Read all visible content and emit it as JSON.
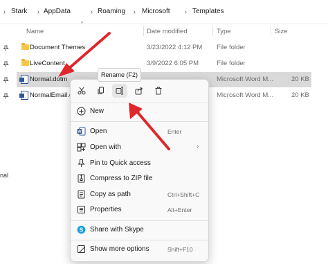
{
  "breadcrumb": {
    "items": [
      "Stark",
      "AppData",
      "Roaming",
      "Microsoft",
      "Templates"
    ],
    "separator_icon": "chevron-right-icon"
  },
  "columns": {
    "name": "Name",
    "date_modified": "Date modified",
    "type": "Type",
    "size": "Size"
  },
  "files": [
    {
      "name": "Document Themes",
      "date": "3/23/2022 4:12 PM",
      "type": "File folder",
      "size": "",
      "icon": "folder-icon"
    },
    {
      "name": "LiveContent",
      "date": "3/9/2022 6:05 PM",
      "type": "File folder",
      "size": "",
      "icon": "folder-icon"
    },
    {
      "name": "Normal.dotm",
      "date": "",
      "type": "Microsoft Word M...",
      "size": "20 KB",
      "icon": "word-doc-icon"
    },
    {
      "name": "NormalEmail.d",
      "date": "",
      "type": "Microsoft Word M...",
      "size": "20 KB",
      "icon": "word-doc-icon"
    }
  ],
  "left_strip_text": "nal",
  "tooltip": "Rename (F2)",
  "context_menu": {
    "quick_actions": [
      {
        "name": "cut",
        "icon": "scissors-icon"
      },
      {
        "name": "copy",
        "icon": "copy-icon"
      },
      {
        "name": "rename",
        "icon": "rename-icon"
      },
      {
        "name": "share",
        "icon": "share-icon"
      },
      {
        "name": "delete",
        "icon": "trash-icon"
      }
    ],
    "items": [
      {
        "label": "New",
        "shortcut": "",
        "icon": "plus-circle-icon"
      },
      {
        "label": "Open",
        "shortcut": "Enter",
        "icon": "word-icon"
      },
      {
        "label": "Open with",
        "shortcut": "",
        "icon": "open-with-icon",
        "submenu": true
      },
      {
        "label": "Pin to Quick access",
        "shortcut": "",
        "icon": "pin-icon"
      },
      {
        "label": "Compress to ZIP file",
        "shortcut": "",
        "icon": "zip-icon"
      },
      {
        "label": "Copy as path",
        "shortcut": "Ctrl+Shift+C",
        "icon": "path-icon"
      },
      {
        "label": "Properties",
        "shortcut": "Alt+Enter",
        "icon": "properties-icon"
      },
      {
        "label": "Share with Skype",
        "shortcut": "",
        "icon": "skype-icon"
      },
      {
        "label": "Show more options",
        "shortcut": "Shift+F10",
        "icon": "more-options-icon"
      }
    ]
  },
  "colors": {
    "selected_row": "#d9d9d9",
    "menu_background": "#f9f9f9",
    "annotation_arrow": "#e0262c",
    "word_blue": "#2b5797",
    "skype_blue": "#1a9ee0",
    "folder_yellow": "#f3c64e"
  }
}
